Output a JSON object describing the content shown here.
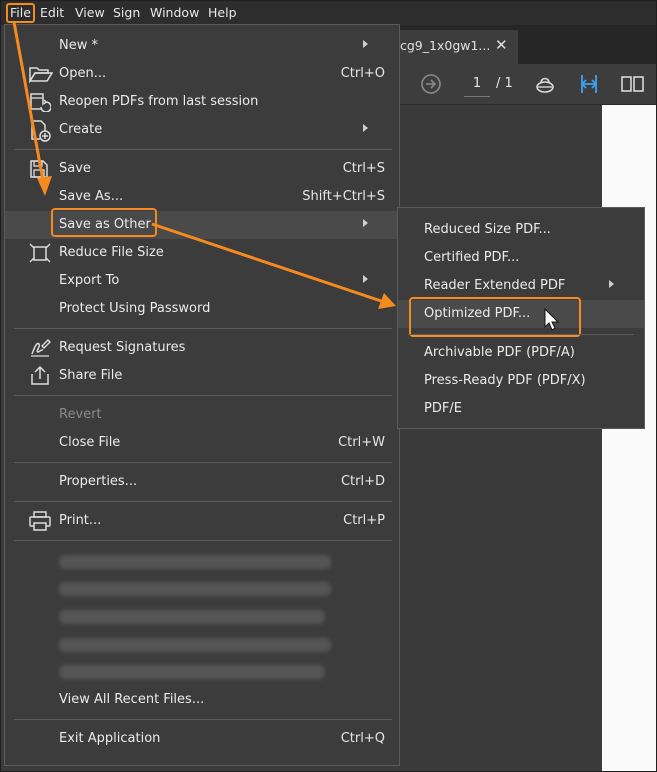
{
  "menubar": {
    "file": "File",
    "edit": "Edit",
    "view": "View",
    "sign": "Sign",
    "window": "Window",
    "help": "Help"
  },
  "tab": {
    "title": "cg9_1x0gw1...",
    "close": "✕"
  },
  "toolbar": {
    "page_current": "1",
    "page_total": "/ 1"
  },
  "file_menu": {
    "new": "New *",
    "open": "Open...",
    "open_shortcut": "Ctrl+O",
    "reopen": "Reopen PDFs from last session",
    "create": "Create",
    "save": "Save",
    "save_shortcut": "Ctrl+S",
    "save_as": "Save As...",
    "save_as_shortcut": "Shift+Ctrl+S",
    "save_as_other": "Save as Other",
    "reduce_size": "Reduce File Size",
    "export_to": "Export To",
    "protect": "Protect Using Password",
    "request_signatures": "Request Signatures",
    "share_file": "Share File",
    "revert": "Revert",
    "close_file": "Close File",
    "close_shortcut": "Ctrl+W",
    "properties": "Properties...",
    "properties_shortcut": "Ctrl+D",
    "print": "Print...",
    "print_shortcut": "Ctrl+P",
    "view_all_recent": "View All Recent Files...",
    "exit": "Exit Application",
    "exit_shortcut": "Ctrl+Q"
  },
  "save_as_other_submenu": {
    "reduced_size": "Reduced Size PDF...",
    "certified": "Certified PDF...",
    "reader_extended": "Reader Extended PDF",
    "optimized": "Optimized PDF...",
    "archivable": "Archivable PDF (PDF/A)",
    "press_ready": "Press-Ready PDF (PDF/X)",
    "pdf_e": "PDF/E"
  },
  "colors": {
    "highlight_box": "#f58a1f",
    "menu_bg": "#3c3c3c",
    "menubar_bg": "#2d2d2d"
  },
  "icons": [
    "folder-open-icon",
    "reopen-icon",
    "create-pdf-icon",
    "save-icon",
    "reduce-size-icon",
    "signature-icon",
    "share-icon",
    "printer-icon",
    "cursor-arrow-icon"
  ]
}
